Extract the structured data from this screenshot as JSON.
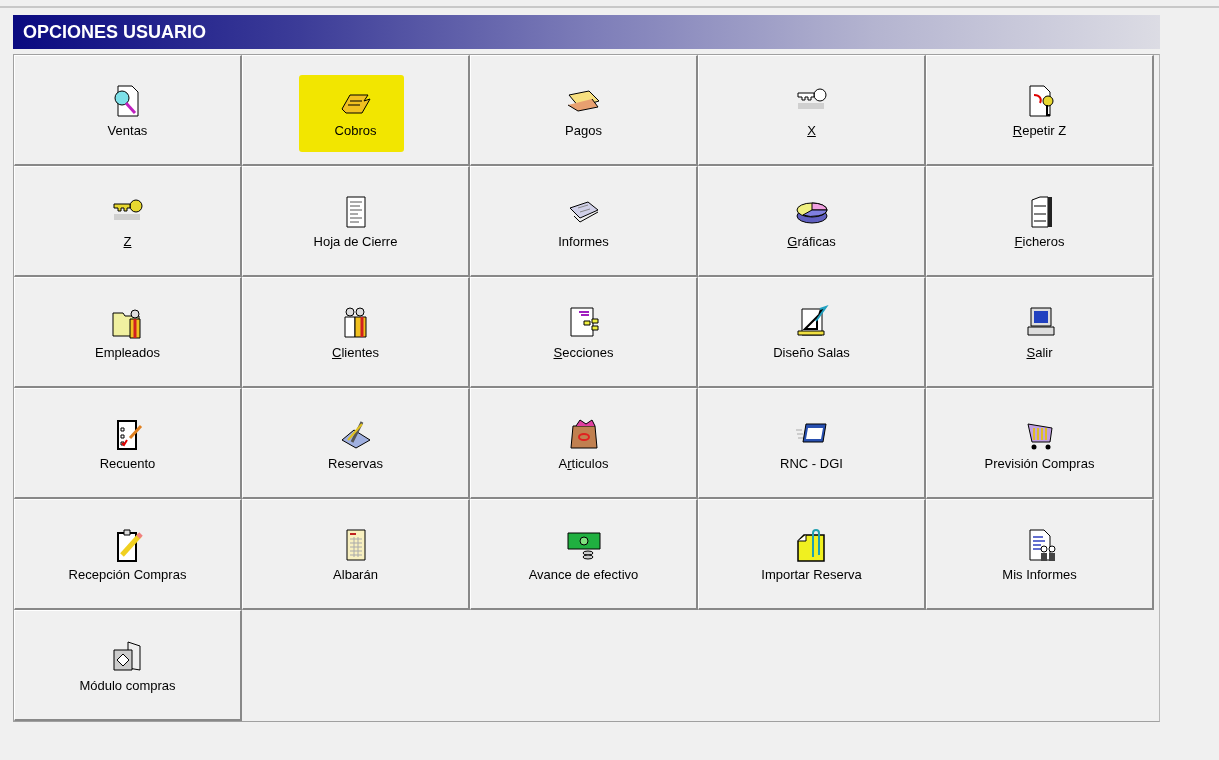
{
  "header": {
    "title": "OPCIONES USUARIO"
  },
  "options": [
    {
      "label": "Ventas",
      "highlighted": false
    },
    {
      "label": "Cobros",
      "highlighted": true
    },
    {
      "label": "Pagos",
      "highlighted": false
    },
    {
      "key": "X",
      "highlighted": false
    },
    {
      "key": "R",
      "after": "epetir Z",
      "highlighted": false
    },
    {
      "key": "Z",
      "highlighted": false
    },
    {
      "label": "Hoja de Cierre",
      "highlighted": false
    },
    {
      "label": "Informes",
      "highlighted": false
    },
    {
      "key": "G",
      "after": "ráficas",
      "highlighted": false
    },
    {
      "key": "F",
      "after": "icheros",
      "highlighted": false
    },
    {
      "label": "Empleados",
      "highlighted": false
    },
    {
      "key": "C",
      "after": "lientes",
      "highlighted": false
    },
    {
      "key": "S",
      "after": "ecciones",
      "highlighted": false
    },
    {
      "label": "Diseño Salas",
      "highlighted": false
    },
    {
      "key": "S",
      "after": "alir",
      "highlighted": false
    },
    {
      "label": "Recuento",
      "highlighted": false
    },
    {
      "label": "Reservas",
      "highlighted": false
    },
    {
      "before": "A",
      "key": "r",
      "after": "ticulos",
      "highlighted": false
    },
    {
      "label": "RNC - DGI",
      "highlighted": false
    },
    {
      "label": "Previsión Compras",
      "highlighted": false
    },
    {
      "label": "Recepción Compras",
      "highlighted": false
    },
    {
      "label": "Albarán",
      "highlighted": false
    },
    {
      "label": "Avance de efectivo",
      "highlighted": false
    },
    {
      "label": "Importar Reserva",
      "highlighted": false
    },
    {
      "label": "Mis Informes",
      "highlighted": false
    },
    {
      "label": "Módulo compras",
      "highlighted": false
    }
  ]
}
